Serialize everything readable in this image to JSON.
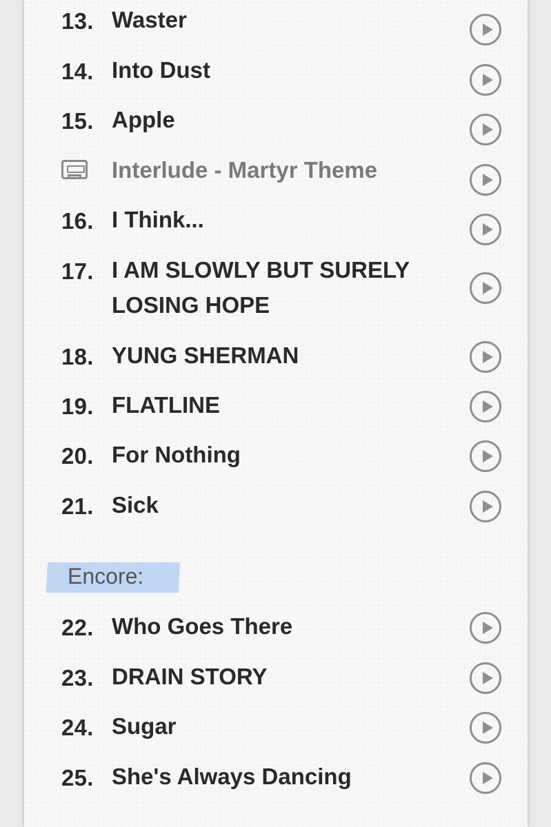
{
  "tracks_before": [
    {
      "number": "13.",
      "title": "Waster"
    },
    {
      "number": "14.",
      "title": "Into Dust"
    },
    {
      "number": "15.",
      "title": "Apple"
    },
    {
      "interlude": true,
      "icon": "cassette-tape-icon",
      "title": "Interlude - Martyr Theme"
    },
    {
      "number": "16.",
      "title": "I Think..."
    },
    {
      "number": "17.",
      "title": "I AM SLOWLY BUT SURELY LOSING HOPE"
    },
    {
      "number": "18.",
      "title": "YUNG SHERMAN"
    },
    {
      "number": "19.",
      "title": "FLATLINE"
    },
    {
      "number": "20.",
      "title": "For Nothing"
    },
    {
      "number": "21.",
      "title": "Sick"
    }
  ],
  "encore_label": "Encore:",
  "tracks_encore": [
    {
      "number": "22.",
      "title": "Who Goes There"
    },
    {
      "number": "23.",
      "title": "DRAIN STORY"
    },
    {
      "number": "24.",
      "title": "Sugar"
    },
    {
      "number": "25.",
      "title": "She's Always Dancing"
    }
  ],
  "icons": {
    "play": "play-circle-icon",
    "interlude": "cassette-tape-icon"
  },
  "colors": {
    "text": "#2a2a2a",
    "muted": "#7a7a7a",
    "icon": "#8f8f8f",
    "highlight": "#96bcf0"
  }
}
